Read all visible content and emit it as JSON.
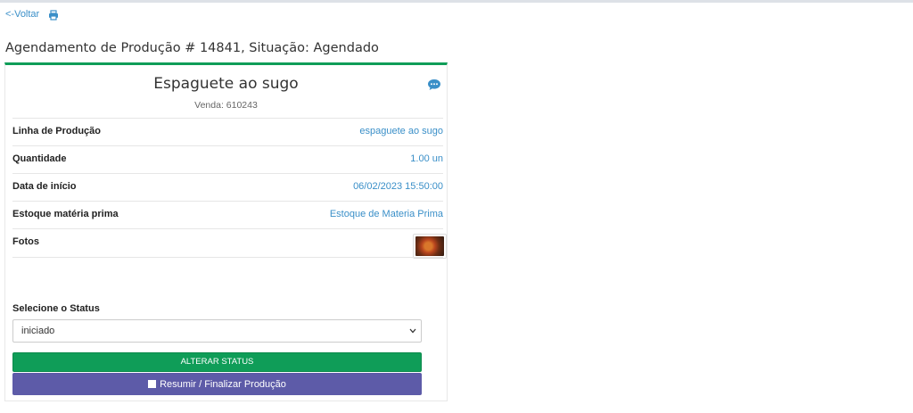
{
  "nav": {
    "back_label": "<-Voltar",
    "print_icon": "print-icon"
  },
  "page_title": "Agendamento de Produção # 14841, Situação: Agendado",
  "product": {
    "name": "Espaguete ao sugo",
    "sale": "Venda: 610243",
    "comment_icon": "comment-icon"
  },
  "details": [
    {
      "label": "Linha de Produção",
      "value": "espaguete ao sugo"
    },
    {
      "label": "Quantidade",
      "value": "1.00 un"
    },
    {
      "label": "Data de início",
      "value": "06/02/2023 15:50:00"
    },
    {
      "label": "Estoque matéria prima",
      "value": "Estoque de Materia Prima"
    }
  ],
  "photos": {
    "label": "Fotos"
  },
  "status": {
    "label": "Selecione o Status",
    "selected": "iniciado",
    "change_button": "ALTERAR STATUS",
    "finish_button": "Resumir / Finalizar Produção"
  },
  "colors": {
    "accent_green": "#0f9d58",
    "link_blue": "#3a8fc8",
    "purple": "#5d5ba8"
  }
}
